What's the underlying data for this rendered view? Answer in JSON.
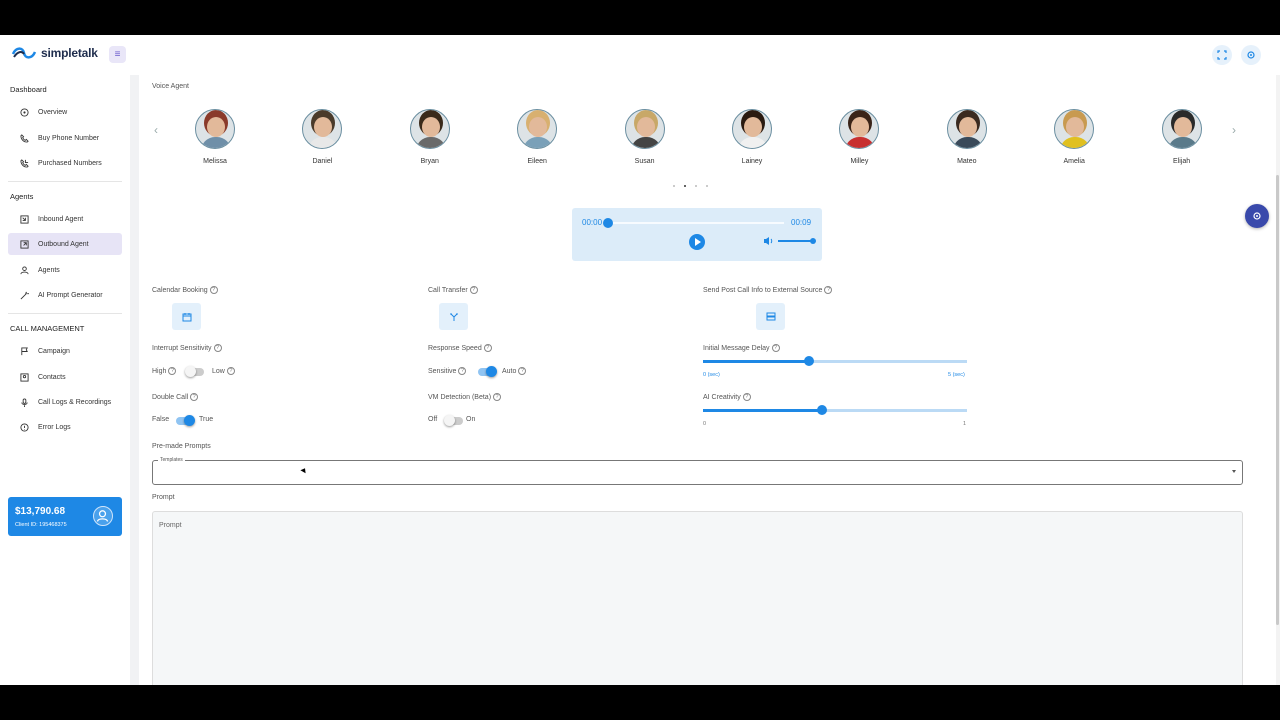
{
  "app": {
    "name": "simpletalk"
  },
  "sidebar": {
    "sections": [
      {
        "title": "Dashboard",
        "items": [
          {
            "label": "Overview",
            "icon": "overview-icon"
          },
          {
            "label": "Buy Phone Number",
            "icon": "phone-icon"
          },
          {
            "label": "Purchased Numbers",
            "icon": "phone-incoming-icon"
          }
        ]
      },
      {
        "title": "Agents",
        "items": [
          {
            "label": "Inbound Agent",
            "icon": "inbound-icon"
          },
          {
            "label": "Outbound Agent",
            "icon": "outbound-icon",
            "active": true
          },
          {
            "label": "Agents",
            "icon": "person-icon"
          },
          {
            "label": "AI Prompt Generator",
            "icon": "magic-wand-icon"
          }
        ]
      },
      {
        "title": "CALL MANAGEMENT",
        "items": [
          {
            "label": "Campaign",
            "icon": "flag-icon"
          },
          {
            "label": "Contacts",
            "icon": "contacts-icon"
          },
          {
            "label": "Call Logs & Recordings",
            "icon": "mic-icon"
          },
          {
            "label": "Error Logs",
            "icon": "error-icon"
          }
        ]
      }
    ],
    "balance": {
      "amount": "$13,790.68",
      "client_id": "Client ID: 195468375"
    }
  },
  "main": {
    "voice_agent_label": "Voice Agent",
    "agents": [
      {
        "name": "Melissa",
        "hair": "#8a3a2a",
        "shirt": "#6f8fa8"
      },
      {
        "name": "Daniel",
        "hair": "#4a3a2a",
        "shirt": "#e8e8e8"
      },
      {
        "name": "Bryan",
        "hair": "#3a2a1a",
        "shirt": "#6a6a6a"
      },
      {
        "name": "Eileen",
        "hair": "#d8b070",
        "shirt": "#7aa0b8"
      },
      {
        "name": "Susan",
        "hair": "#c8a868",
        "shirt": "#444444"
      },
      {
        "name": "Lainey",
        "hair": "#2a1a10",
        "shirt": "#f0f0f0"
      },
      {
        "name": "Milley",
        "hair": "#3a2418",
        "shirt": "#c83030"
      },
      {
        "name": "Mateo",
        "hair": "#3a2a20",
        "shirt": "#3a4a5a"
      },
      {
        "name": "Amelia",
        "hair": "#c89a50",
        "shirt": "#e0c020"
      },
      {
        "name": "Elijah",
        "hair": "#2a2a2a",
        "shirt": "#5a7a8a"
      }
    ],
    "player": {
      "current": "00:00",
      "duration": "00:09",
      "progress": 0
    },
    "features": {
      "calendar_booking": "Calendar Booking",
      "call_transfer": "Call Transfer",
      "post_call": "Send Post Call Info to External Source",
      "interrupt_sensitivity": "Interrupt Sensitivity",
      "interrupt_high": "High",
      "interrupt_low": "Low",
      "response_speed": "Response Speed",
      "speed_sensitive": "Sensitive",
      "speed_auto": "Auto",
      "initial_delay": "Initial Message Delay",
      "delay_min": "0 (sec)",
      "delay_max": "5 (sec)",
      "delay_value_fraction": 0.4,
      "double_call": "Double Call",
      "double_false": "False",
      "double_true": "True",
      "vm_detection": "VM Detection (Beta)",
      "vm_off": "Off",
      "vm_on": "On",
      "ai_creativity": "AI Creativity",
      "creativity_min": "0",
      "creativity_max": "1",
      "creativity_value": 0.45
    },
    "premade_prompts_label": "Pre-made Prompts",
    "templates_legend": "Templates",
    "prompt_label": "Prompt",
    "prompt_placeholder": "Prompt"
  },
  "colors": {
    "accent": "#1e88e5",
    "active_nav": "#e7e4f6",
    "fab": "#3949ab"
  }
}
